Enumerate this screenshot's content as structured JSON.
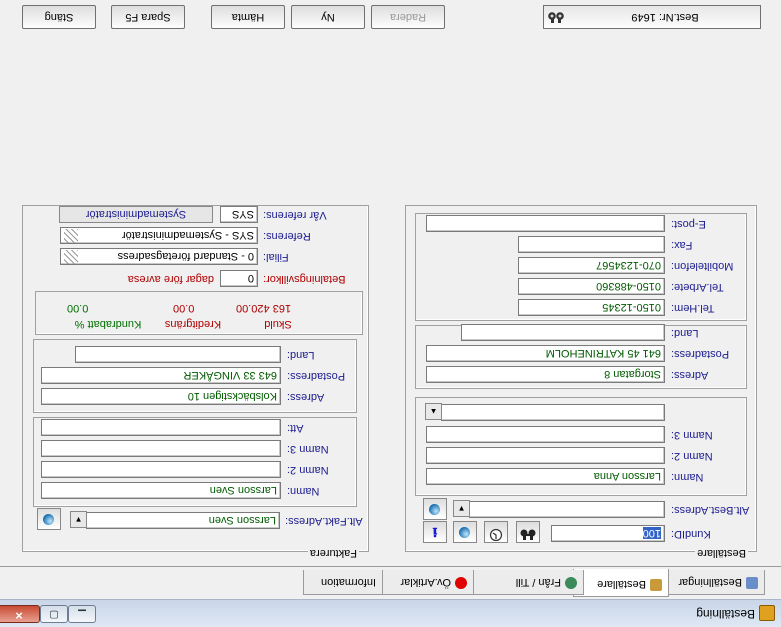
{
  "window": {
    "title": "Beställning",
    "controls": {
      "minimize": "▁",
      "maximize": "▢",
      "close": "✕"
    }
  },
  "tabs": [
    {
      "label": "Beställningar",
      "icon": "orders-icon"
    },
    {
      "label": "Beställare",
      "icon": "customer-icon"
    },
    {
      "label": "Från / Till",
      "icon": "globe-icon"
    },
    {
      "label": "Öv.Artiklar",
      "icon": "red-dot-icon"
    },
    {
      "label": "Information",
      "icon": ""
    }
  ],
  "orderer": {
    "group_label": "Beställare",
    "kundid_label": "KundID:",
    "kundid_value": "100",
    "alt_address_label": "Alt.Best.Adress:",
    "name_label": "Namn:",
    "name_value": "Larsson Anna",
    "name2_label": "Namn 2:",
    "name3_label": "Namn 3:",
    "address_label": "Adress:",
    "address_value": "Storgatan 8",
    "postaddress_label": "Postadress:",
    "postaddress_value": "641 45  KATRINEHOLM",
    "country_label": "Land:",
    "tel_home_label": "Tel.Hem:",
    "tel_home_value": "0150-12345",
    "tel_work_label": "Tel.Arbete:",
    "tel_work_value": "0150-488360",
    "mobile_label": "Mobiltelefon:",
    "mobile_value": "070-1234567",
    "fax_label": "Fax:",
    "email_label": "E-post:"
  },
  "billing": {
    "group_label": "Fakturera",
    "alt_address_label": "Alt.Fakt.Adress:",
    "alt_address_value": "Larsson Sven",
    "name_label": "Namn:",
    "name_value": "Larsson Sven",
    "name2_label": "Namn 2:",
    "name3_label": "Namn 3:",
    "att_label": "Att:",
    "address_label": "Adress:",
    "address_value": "Kolsbäckstigen 10",
    "postaddress_label": "Postadress:",
    "postaddress_value": "643 33  VINGÅKER",
    "country_label": "Land:",
    "debt_label": "Skuld",
    "debt_value": "163 420.00",
    "credit_label": "Kreditgräns",
    "credit_value": "0.00",
    "discount_label": "Kundrabatt %",
    "discount_value": "0.00",
    "payment_label": "Betalningsvillkor:",
    "payment_value": "0",
    "payment_suffix": "dagar före avresa",
    "branch_label": "Filial:",
    "branch_value": "0  - Standard företagsadress",
    "reference_label": "Referens:",
    "reference_value": "SYS  - Systemadministratör",
    "our_reference_label": "Vår referens:",
    "our_reference_code": "SYS",
    "our_reference_name": "Systemadministratör"
  },
  "actions": {
    "order_number": "Best.Nr: 1649",
    "delete": "Radera",
    "new": "Ny",
    "fetch": "Hämta",
    "save": "Spara F5",
    "close": "Stäng"
  },
  "colors": {
    "field_value": "#005a00",
    "label": "#1b1b8f",
    "debt": "#b00000"
  }
}
